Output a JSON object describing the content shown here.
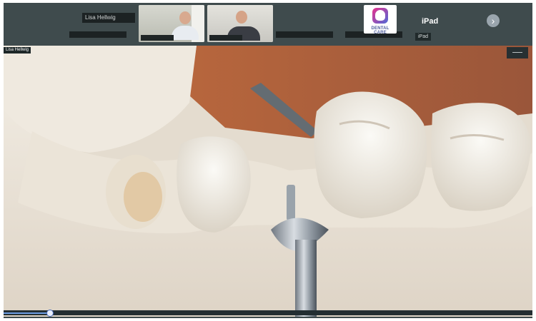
{
  "toolbar": {
    "participants": [
      {
        "name": "Lisa Hellwig"
      },
      {
        "name": ""
      },
      {
        "name": ""
      },
      {
        "name": ""
      },
      {
        "name": ""
      }
    ],
    "logo_label": "DENTAL CARE",
    "ipad_title": "iPad",
    "ipad_chip": "iPad",
    "next_icon": "chevron-right-icon"
  },
  "main_view": {
    "speaker_tag": "Lisa Hellwig",
    "corner_tab_icon": "minimize-icon"
  },
  "colors": {
    "strip_bg": "#3f4b4d",
    "progress_accent": "#6d9de2",
    "logo_gradient_start": "#e9318d",
    "logo_gradient_end": "#4e69d7",
    "model_base": "#efe9df",
    "wood": "#b96b46"
  },
  "playback": {
    "progress": 0.09
  }
}
